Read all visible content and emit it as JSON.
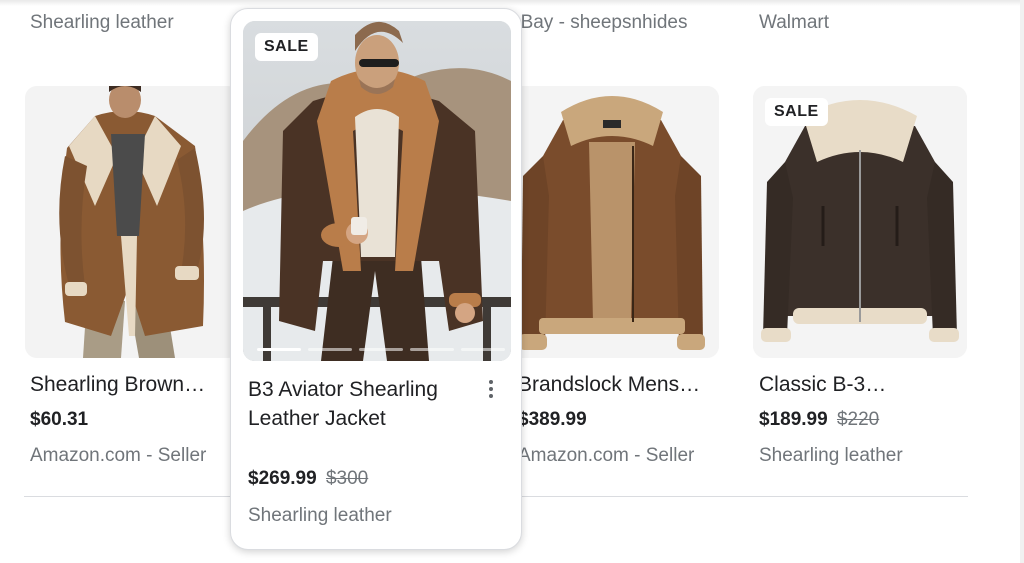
{
  "previous_row": {
    "col1_sub": "Shearling leather",
    "col3_sub": "eBay - sheepsnhides",
    "col4_sub": "Walmart"
  },
  "products": [
    {
      "title": "Shearling Brown…",
      "price": "$60.31",
      "old_price": "",
      "seller": "Amazon.com - Seller",
      "sale": ""
    },
    {
      "title": "B3 Aviator Shearling Leather Jacket",
      "price": "$269.99",
      "old_price": "$300",
      "seller": "Shearling leather",
      "sale": "SALE"
    },
    {
      "title": "Brandslock Mens…",
      "price": "$389.99",
      "old_price": "",
      "seller": "Amazon.com - Seller",
      "sale": ""
    },
    {
      "title": "Classic B-3…",
      "price": "$189.99",
      "old_price": "$220",
      "seller": "Shearling leather",
      "sale": "SALE"
    }
  ],
  "carousel": {
    "slides": 5,
    "active": 1
  },
  "icons": {
    "more": "more-vert-icon"
  },
  "colors": {
    "text": "#202124",
    "muted": "#70757a",
    "divider": "#dadce0"
  }
}
